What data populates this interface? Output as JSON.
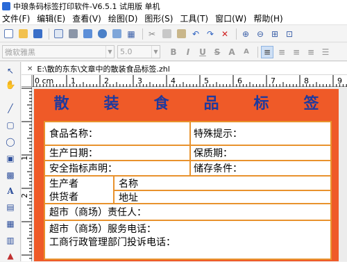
{
  "window": {
    "title": "中琅条码标签打印软件-V6.5.1 试用版 单机"
  },
  "menu": {
    "items": [
      "文件(F)",
      "编辑(E)",
      "查看(V)",
      "绘图(D)",
      "图形(S)",
      "工具(T)",
      "窗口(W)",
      "帮助(H)"
    ]
  },
  "toolbar": {
    "icons": [
      "new-file-icon",
      "open-folder-icon",
      "save-icon",
      "print-preview-icon",
      "print-icon",
      "data-source-icon",
      "database-icon",
      "settings-icon",
      "grid-icon",
      "cut-icon",
      "copy-icon",
      "paste-icon",
      "undo-icon",
      "redo-icon",
      "delete-icon",
      "zoom-in-icon",
      "zoom-out-icon",
      "fit-page-icon",
      "actual-size-icon"
    ]
  },
  "format_bar": {
    "font_placeholder": "微软雅黑",
    "size_placeholder": "5.0",
    "buttons": [
      "B",
      "I",
      "U",
      "S",
      "A",
      "A"
    ]
  },
  "document": {
    "tab_path": "E:\\散的东东\\文章中的散装食品标签.zhl"
  },
  "ruler": {
    "origin_label": "0 cm",
    "ticks_h": [
      "1",
      "2",
      "3",
      "4",
      "5",
      "6",
      "7",
      "8",
      "9"
    ],
    "ticks_v": [
      "1",
      "2"
    ]
  },
  "label": {
    "title_chars": [
      "散",
      "装",
      "食",
      "品",
      "标",
      "签"
    ],
    "rows": {
      "food_name": "食品名称：",
      "special_note": "特殊提示：",
      "production_date": "生产日期：",
      "shelf_life": "保质期：",
      "safety_standard": "安全指标声明：",
      "storage": "储存条件：",
      "producer_line1": "生产者",
      "producer_line2": "供货者",
      "name": "名称",
      "address": "地址",
      "supermarket_person": "超市（商场）责任人：",
      "service_phone": "超市（商场）服务电话：",
      "complaint_phone": "工商行政管理部门投诉电话："
    }
  },
  "colors": {
    "label_bg": "#ef5a28",
    "table_border": "#e8922d",
    "title_text": "#1f3a9e"
  }
}
